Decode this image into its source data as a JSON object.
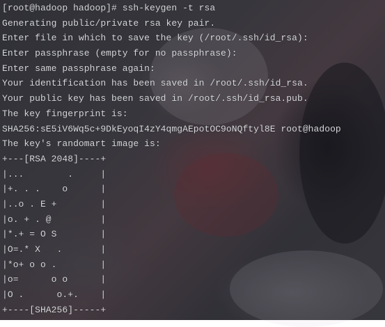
{
  "terminal": {
    "lines": [
      "[root@hadoop hadoop]# ssh-keygen -t rsa",
      "Generating public/private rsa key pair.",
      "Enter file in which to save the key (/root/.ssh/id_rsa):",
      "Enter passphrase (empty for no passphrase):",
      "Enter same passphrase again:",
      "Your identification has been saved in /root/.ssh/id_rsa.",
      "Your public key has been saved in /root/.ssh/id_rsa.pub.",
      "The key fingerprint is:",
      "SHA256:sE5iV6Wq5c+9DkEyoqI4zY4qmgAEpotOC9oNQftyl8E root@hadoop",
      "The key's randomart image is:",
      "+---[RSA 2048]----+",
      "|...        .     |",
      "|+. . .    o      |",
      "|..o . E +        |",
      "|o. + . @         |",
      "|*.+ = O S        |",
      "|O=.* X   .       |",
      "|*o+ o o .        |",
      "|o=      o o      |",
      "|O .      o.+.    |",
      "+----[SHA256]-----+"
    ]
  },
  "colors": {
    "text": "#d7d9dc",
    "background_tint": "#2a2a30"
  }
}
